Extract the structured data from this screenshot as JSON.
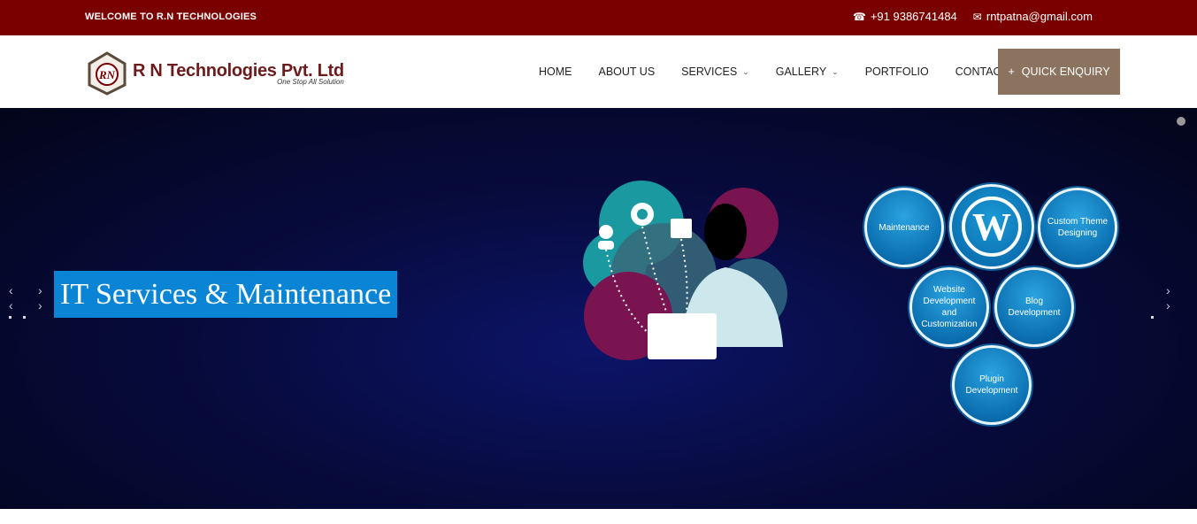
{
  "topbar": {
    "welcome": "WELCOME TO R.N TECHNOLOGIES",
    "phone": "+91 9386741484",
    "email": "rntpatna@gmail.com"
  },
  "logo": {
    "title": "R N Technologies Pvt. Ltd",
    "tagline": "One Stop All Solution"
  },
  "nav": {
    "home": "HOME",
    "about": "ABOUT US",
    "services": "SERVICES",
    "gallery": "GALLERY",
    "portfolio": "PORTFOLIO",
    "contact": "CONTACT",
    "enquiry": "QUICK ENQUIRY"
  },
  "slider": {
    "caption": "IT Services & Maintenance",
    "bubbles": {
      "maintenance": "Maintenance",
      "theme": "Custom Theme Designing",
      "website": "Website Development and Customization",
      "blog": "Blog Development",
      "plugin": "Plugin Development"
    }
  },
  "colors": {
    "topbar": "#7a0000",
    "enquiry": "#8b7360",
    "caption": "#0a85d6"
  }
}
